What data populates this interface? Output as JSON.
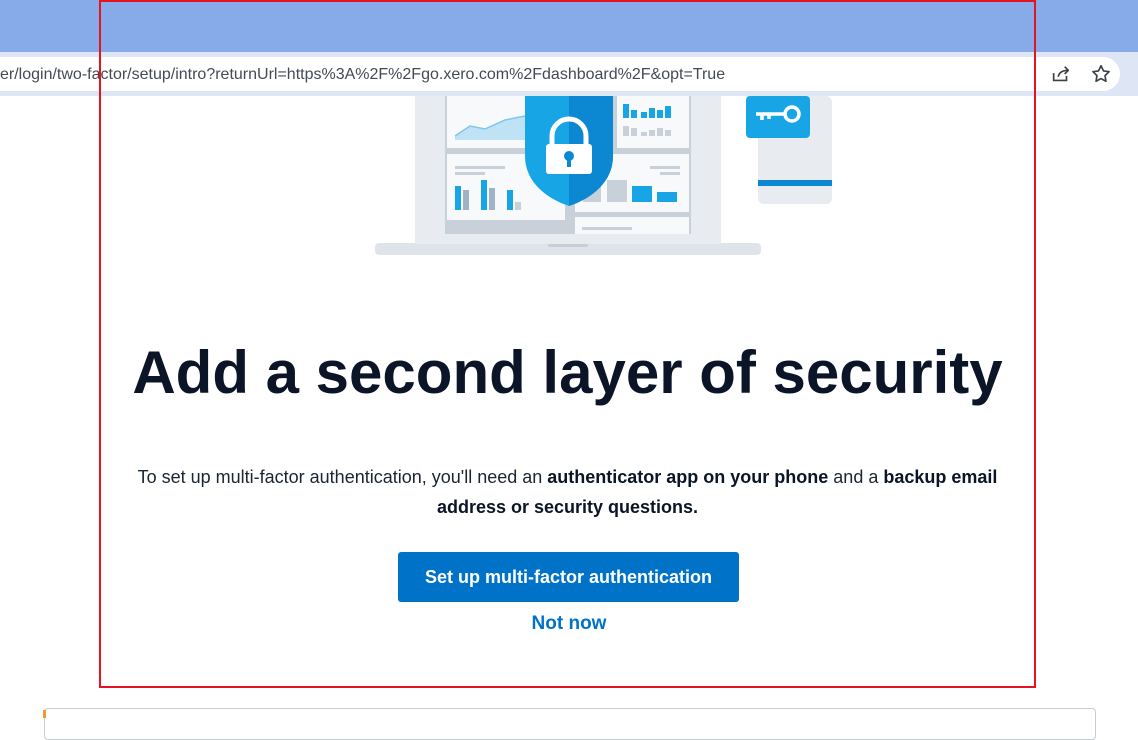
{
  "browser": {
    "url": "er/login/two-factor/setup/intro?returnUrl=https%3A%2F%2Fgo.xero.com%2Fdashboard%2F&opt=True",
    "share_icon": "share-icon",
    "bookmark_icon": "star-icon"
  },
  "illustration": {
    "icons": [
      "laptop-icon",
      "shield-lock-icon",
      "phone-icon",
      "key-icon"
    ]
  },
  "main": {
    "title": "Add a second layer of security",
    "description_parts": {
      "p1": "To set up multi-factor authentication, you'll need an ",
      "b1": "authenticator app on your phone",
      "p2": " and a ",
      "b2": "backup email address or security questions."
    },
    "primary_button": "Set up multi-factor authentication",
    "secondary_link": "Not now"
  },
  "colors": {
    "accent": "#0073c9",
    "title": "#0c1527",
    "browser_top": "#87abe9",
    "highlight_frame": "#e3141f"
  }
}
